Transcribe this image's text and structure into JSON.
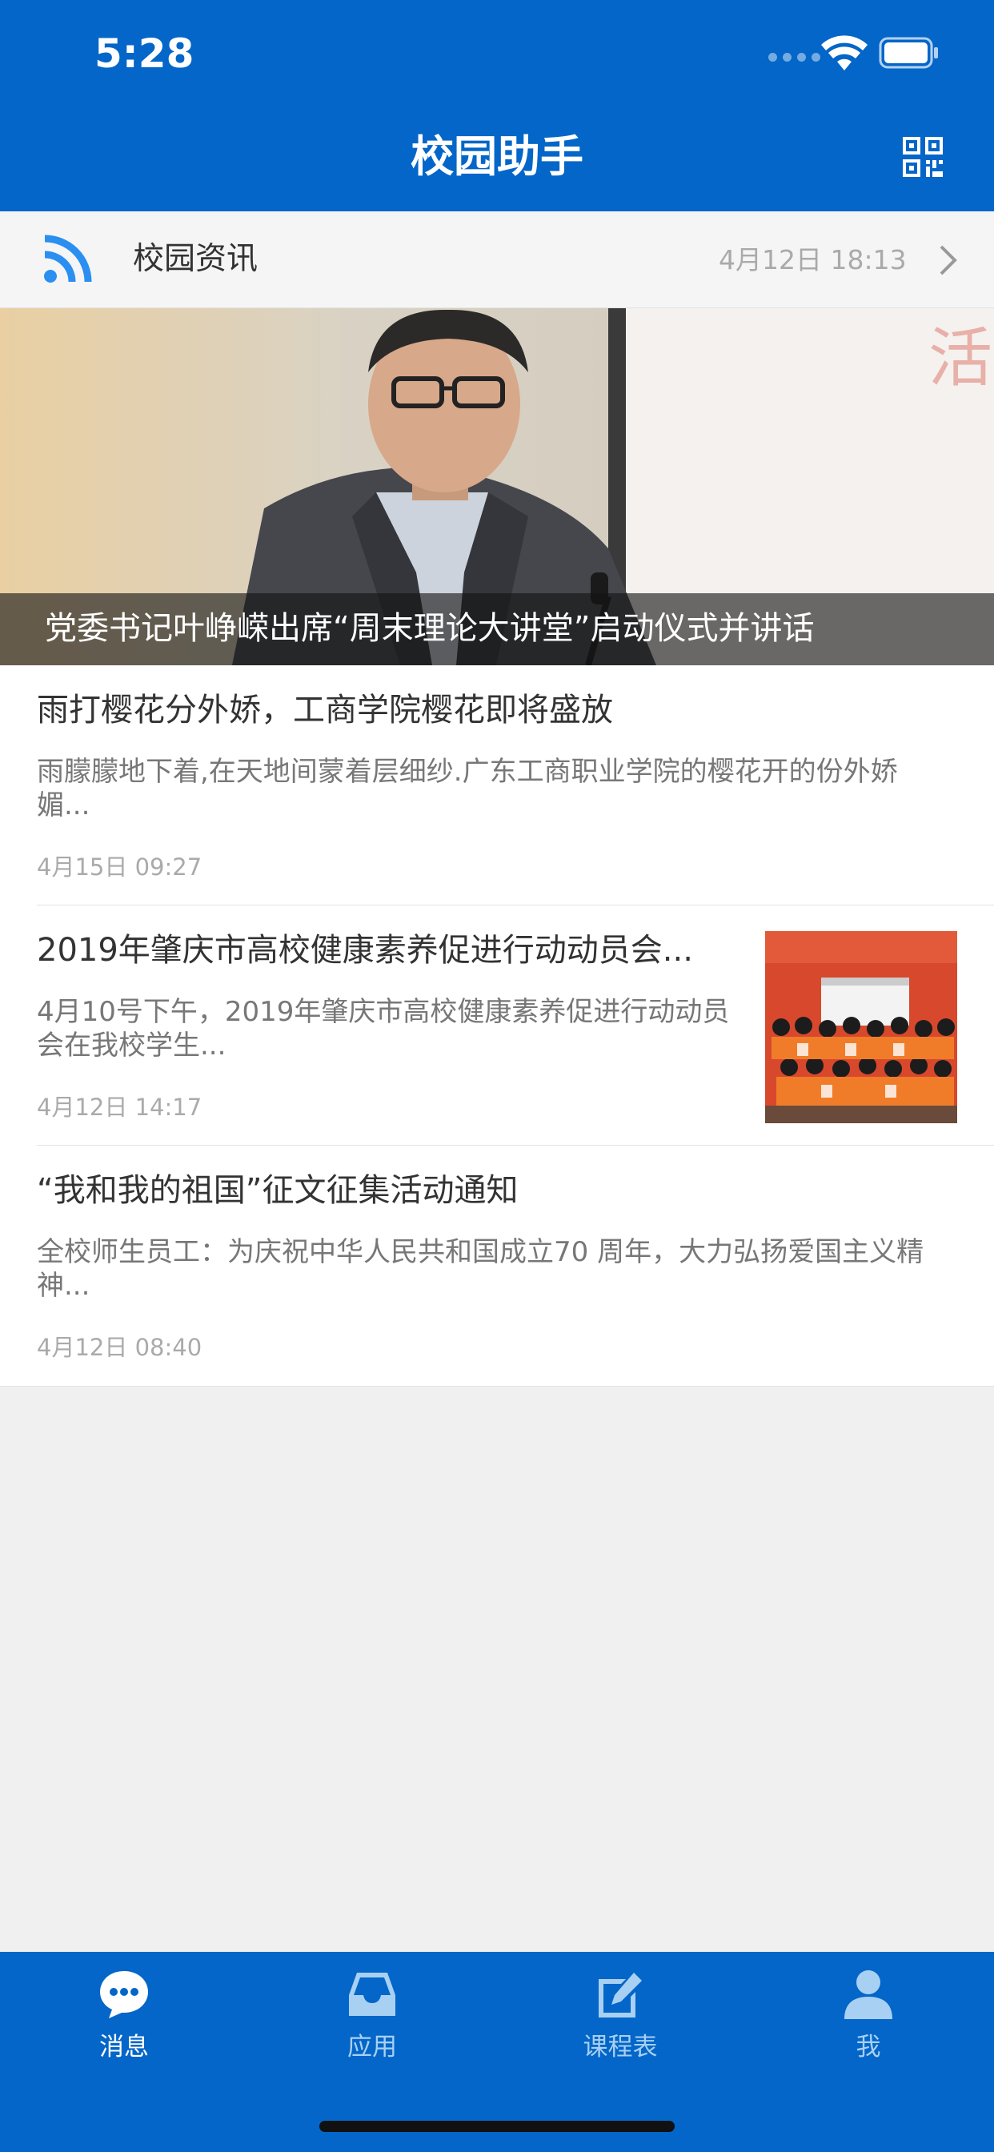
{
  "status_bar": {
    "time": "5:28"
  },
  "header": {
    "title": "校园助手"
  },
  "news_section": {
    "title": "校园资讯",
    "updated": "4月12日 18:13"
  },
  "banner": {
    "caption": "党委书记叶峥嵘出席“周末理论大讲堂”启动仪式并讲话"
  },
  "articles": [
    {
      "title": "雨打樱花分外娇，工商学院樱花即将盛放",
      "summary": "雨朦朦地下着,在天地间蒙着层细纱.广东工商职业学院的樱花开的份外娇媚...",
      "time": "4月15日 09:27"
    },
    {
      "title": "2019年肇庆市高校健康素养促进行动动员会...",
      "summary": " 4月10号下午，2019年肇庆市高校健康素养促进行动动员会在我校学生...",
      "time": "4月12日 14:17"
    },
    {
      "title": "“我和我的祖国”征文征集活动通知",
      "summary": "全校师生员工：为庆祝中华人民共和国成立70 周年，大力弘扬爱国主义精神...",
      "time": "4月12日 08:40"
    }
  ],
  "tabs": [
    {
      "label": "消息",
      "icon": "chat-bubble-icon",
      "active": true
    },
    {
      "label": "应用",
      "icon": "inbox-tray-icon",
      "active": false
    },
    {
      "label": "课程表",
      "icon": "edit-note-icon",
      "active": false
    },
    {
      "label": "我",
      "icon": "person-icon",
      "active": false
    }
  ],
  "colors": {
    "primary": "#0366c8",
    "active_tab": "#ffffff",
    "inactive_tab": "#a8d0f2",
    "rss_icon": "#2a8ff0"
  }
}
